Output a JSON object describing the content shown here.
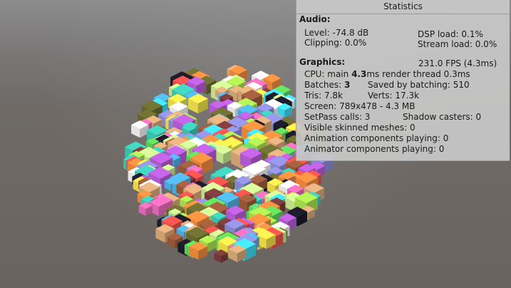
{
  "statistics": {
    "title": "Statistics",
    "audio": {
      "label": "Audio:",
      "level": "Level: -74.8 dB",
      "dsp_load": "DSP load: 0.1%",
      "clipping": "Clipping: 0.0%",
      "stream_load": "Stream load: 0.0%"
    },
    "graphics": {
      "label": "Graphics:",
      "fps": "231.0 FPS (4.3ms)",
      "cpu_prefix": "CPU: main ",
      "cpu_main": "4.3",
      "cpu_suffix": "ms  render thread 0.3ms",
      "batches_prefix": "Batches: ",
      "batches": "3",
      "saved_by_batching": "Saved by batching: 510",
      "tris": "Tris: 7.8k",
      "verts": "Verts: 17.3k",
      "screen": "Screen: 789x478 - 4.3 MB",
      "setpass": "SetPass calls: 3",
      "shadow_casters": "Shadow casters: 0",
      "visible_skinned": "Visible skinned meshes: 0",
      "animation_components": "Animation components playing: 0",
      "animator_components": "Animator components playing: 0"
    }
  },
  "scene": {
    "cube_palette": [
      "#e8504a",
      "#5fd35a",
      "#4fb0e0",
      "#b85cd8",
      "#f0e04a",
      "#f08a3c",
      "#8c8cd8",
      "#c8e890",
      "#e86ab8",
      "#3cc8b4",
      "#a8e050",
      "#6a6a30",
      "#7a3a3a",
      "#d8a878",
      "#f0f0f0",
      "#1a1a2a",
      "#40d8f0",
      "#9a5a3a"
    ]
  }
}
